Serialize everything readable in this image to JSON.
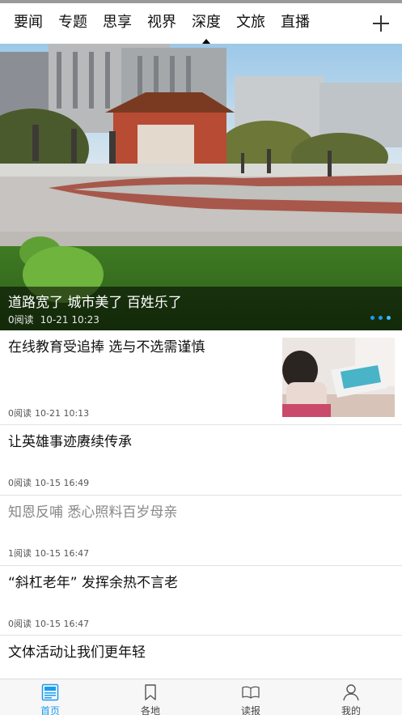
{
  "tabs": [
    {
      "label": "要闻"
    },
    {
      "label": "专题"
    },
    {
      "label": "思享"
    },
    {
      "label": "视界"
    },
    {
      "label": "深度",
      "active": true
    },
    {
      "label": "文旅"
    },
    {
      "label": "直播"
    }
  ],
  "add_icon": "plus-icon",
  "hero": {
    "title": "道路宽了 城市美了 百姓乐了",
    "reads": "0阅读",
    "time": "10-21 10:23",
    "slide_count": 3,
    "active_slide": 3
  },
  "news": [
    {
      "title": "在线教育受追捧 选与不选需谨慎",
      "reads": "0阅读",
      "time": "10-21 10:13",
      "has_thumb": true
    },
    {
      "title": "让英雄事迹赓续传承",
      "reads": "0阅读",
      "time": "10-15 16:49"
    },
    {
      "title": "知恩反哺 悉心照料百岁母亲",
      "reads": "1阅读",
      "time": "10-15 16:47",
      "read": true
    },
    {
      "title": "“斜杠老年” 发挥余热不言老",
      "reads": "0阅读",
      "time": "10-15 16:47"
    },
    {
      "title": "文体活动让我们更年轻",
      "reads": "",
      "time": ""
    }
  ],
  "bottom_nav": [
    {
      "label": "首页",
      "icon": "home-newspaper-icon",
      "active": true
    },
    {
      "label": "各地",
      "icon": "bookmark-icon"
    },
    {
      "label": "读报",
      "icon": "open-book-icon"
    },
    {
      "label": "我的",
      "icon": "person-icon"
    }
  ],
  "colors": {
    "accent": "#1a9cf0",
    "divider": "#e2e2e2",
    "read_title": "#888888"
  }
}
